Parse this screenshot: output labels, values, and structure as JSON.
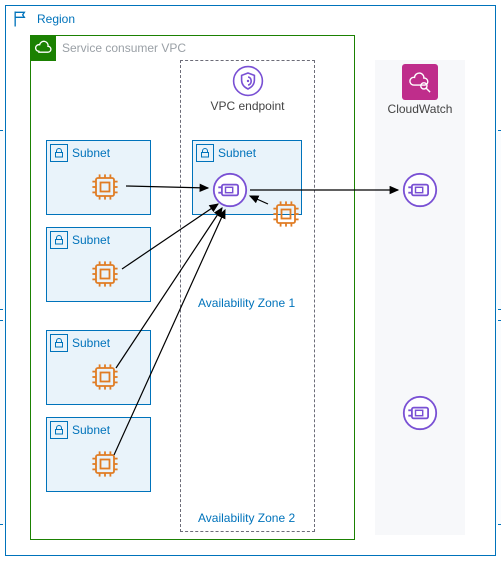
{
  "region": {
    "label": "Region"
  },
  "vpc": {
    "label": "Service consumer VPC"
  },
  "endpoint": {
    "label": "VPC endpoint"
  },
  "cloudwatch": {
    "label": "CloudWatch"
  },
  "az": {
    "label1": "Availability Zone 1",
    "label2": "Availability Zone 2"
  },
  "subnets": {
    "s1": {
      "label": "Subnet"
    },
    "s2": {
      "label": "Subnet"
    },
    "s3": {
      "label": "Subnet"
    },
    "s4": {
      "label": "Subnet"
    },
    "s5": {
      "label": "Subnet"
    }
  }
}
